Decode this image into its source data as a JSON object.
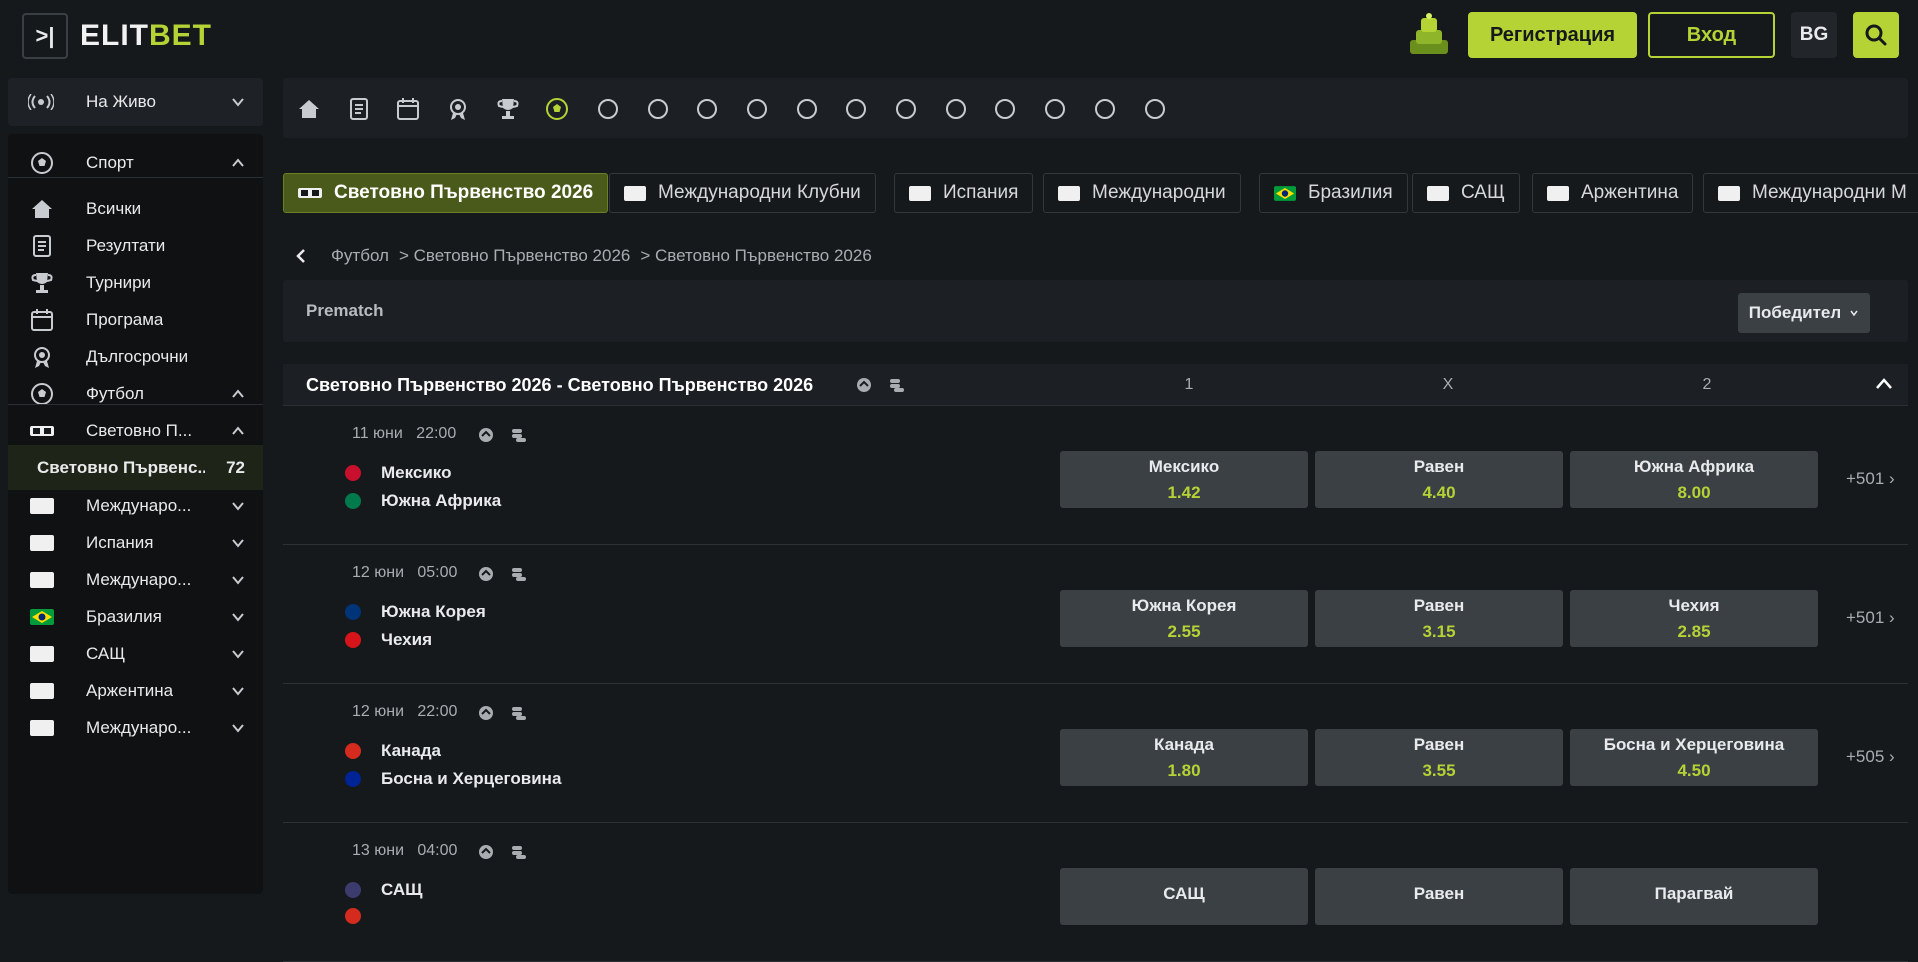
{
  "header": {
    "logo_mark": ">|",
    "logo_text_a": "ELIT",
    "logo_text_b": "BET",
    "register_label": "Регистрация",
    "login_label": "Вход",
    "lang_label": "BG"
  },
  "sidebar": {
    "live_label": "На Живо",
    "items": [
      {
        "label": "Спорт",
        "icon": "soccer-ball-icon"
      },
      {
        "label": "Всички",
        "icon": "home-icon"
      },
      {
        "label": "Резултати",
        "icon": "results-icon"
      },
      {
        "label": "Турнири",
        "icon": "trophy-icon"
      },
      {
        "label": "Програма",
        "icon": "calendar-icon"
      },
      {
        "label": "Дългосрочни",
        "icon": "medal-icon"
      },
      {
        "label": "Футбол",
        "icon": "soccer-ball-icon"
      },
      {
        "label": "Световно П...",
        "icon": "world-cup-flag-icon"
      },
      {
        "label": "Световно Първенс...",
        "count": "72"
      },
      {
        "label": "Междунаро..."
      },
      {
        "label": "Испания"
      },
      {
        "label": "Междунаро..."
      },
      {
        "label": "Бразилия"
      },
      {
        "label": "САЩ"
      },
      {
        "label": "Аржентина"
      },
      {
        "label": "Междунаро..."
      }
    ]
  },
  "sports_bar": [
    "home-icon",
    "results-icon",
    "calendar-icon",
    "medal-icon",
    "trophy-icon",
    "soccer-ball-icon",
    "tennis-icon",
    "basketball-icon",
    "handball-icon",
    "american-football-icon",
    "volleyball-icon",
    "table-tennis-icon",
    "hockey-icon",
    "darts-icon",
    "rugby-icon",
    "baseball-icon",
    "boxing-icon",
    "esports-icon"
  ],
  "chips": [
    {
      "label": "Световно Първенство 2026",
      "active": true
    },
    {
      "label": "Международни Клубни"
    },
    {
      "label": "Испания"
    },
    {
      "label": "Международни"
    },
    {
      "label": "Бразилия"
    },
    {
      "label": "САЩ"
    },
    {
      "label": "Аржентина"
    },
    {
      "label": "Международни М"
    }
  ],
  "breadcrumb": {
    "part1": "Футбол",
    "part2": "> Световно Първенство 2026",
    "part3": "> Световно Първенство 2026"
  },
  "prematch": {
    "label": "Prematch",
    "market_select": "Победител"
  },
  "league": {
    "title": "Световно Първенство 2026 - Световно Първенство 2026",
    "col1": "1",
    "colx": "X",
    "col2": "2"
  },
  "events": [
    {
      "date": "11 юни",
      "time": "22:00",
      "home": "Мексико",
      "away": "Южна Африка",
      "home_flag": "#c8102e",
      "away_flag": "#007a4d",
      "odds": [
        {
          "name": "Мексико",
          "value": "1.42"
        },
        {
          "name": "Равен",
          "value": "4.40"
        },
        {
          "name": "Южна Африка",
          "value": "8.00"
        }
      ],
      "more": "+501"
    },
    {
      "date": "12 юни",
      "time": "05:00",
      "home": "Южна Корея",
      "away": "Чехия",
      "home_flag": "#003478",
      "away_flag": "#d7141a",
      "odds": [
        {
          "name": "Южна Корея",
          "value": "2.55"
        },
        {
          "name": "Равен",
          "value": "3.15"
        },
        {
          "name": "Чехия",
          "value": "2.85"
        }
      ],
      "more": "+501"
    },
    {
      "date": "12 юни",
      "time": "22:00",
      "home": "Канада",
      "away": "Босна и Херцеговина",
      "home_flag": "#d52b1e",
      "away_flag": "#002395",
      "odds": [
        {
          "name": "Канада",
          "value": "1.80"
        },
        {
          "name": "Равен",
          "value": "3.55"
        },
        {
          "name": "Босна и Херцеговина",
          "value": "4.50"
        }
      ],
      "more": "+505"
    },
    {
      "date": "13 юни",
      "time": "04:00",
      "home": "САЩ",
      "away": "",
      "home_flag": "#3c3b6e",
      "away_flag": "#d52b1e",
      "odds": [
        {
          "name": "САЩ",
          "value": ""
        },
        {
          "name": "Равен",
          "value": ""
        },
        {
          "name": "Парагвай",
          "value": ""
        }
      ],
      "more": ""
    }
  ],
  "colors": {
    "accent": "#b5d334",
    "bg": "#16191c",
    "panel": "#1c2024",
    "odd_bg": "#3b4045"
  }
}
